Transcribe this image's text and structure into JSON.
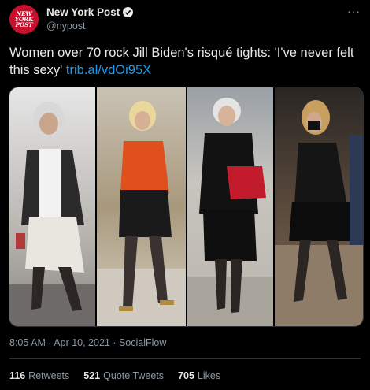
{
  "account": {
    "display_name": "New York Post",
    "handle": "@nypost",
    "avatar_lines": [
      "NEW",
      "YORK",
      "POST"
    ]
  },
  "tweet": {
    "text": "Women over 70 rock Jill Biden's risqué tights: 'I've never felt this sexy' ",
    "link": "trib.al/vdOi95X"
  },
  "meta": {
    "timestamp": "8:05 AM · Apr 10, 2021 · SocialFlow"
  },
  "stats": {
    "retweets_count": "116",
    "retweets_label": "Retweets",
    "quotes_count": "521",
    "quotes_label": "Quote Tweets",
    "likes_count": "705",
    "likes_label": "Likes"
  },
  "icons": {
    "verified": "verified-badge-icon",
    "more": "more-options-icon"
  },
  "colors": {
    "background": "#000000",
    "link": "#1d9bf0",
    "brand_red": "#c8102e"
  }
}
